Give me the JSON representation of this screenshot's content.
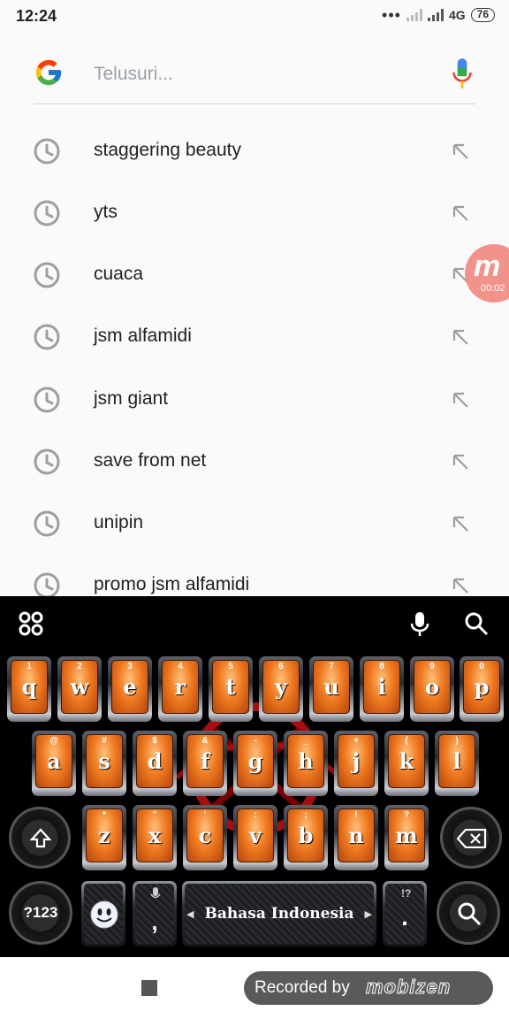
{
  "status_bar": {
    "time": "12:24",
    "network": "4G",
    "battery": "76"
  },
  "search": {
    "placeholder": "Telusuri...",
    "logo": "google-g-icon",
    "voice_icon": "mic-icon"
  },
  "suggestions": [
    {
      "text": "staggering beauty",
      "icon": "history-clock-icon"
    },
    {
      "text": "yts",
      "icon": "history-clock-icon"
    },
    {
      "text": "cuaca",
      "icon": "history-clock-icon"
    },
    {
      "text": "jsm alfamidi",
      "icon": "history-clock-icon"
    },
    {
      "text": "jsm giant",
      "icon": "history-clock-icon"
    },
    {
      "text": "save from net",
      "icon": "history-clock-icon"
    },
    {
      "text": "unipin",
      "icon": "history-clock-icon"
    },
    {
      "text": "promo jsm alfamidi",
      "icon": "history-clock-icon"
    }
  ],
  "recorder_bubble": {
    "time": "00:02"
  },
  "keyboard": {
    "row1": [
      {
        "hint": "1",
        "key": "q"
      },
      {
        "hint": "2",
        "key": "w"
      },
      {
        "hint": "3",
        "key": "e"
      },
      {
        "hint": "4",
        "key": "r"
      },
      {
        "hint": "5",
        "key": "t"
      },
      {
        "hint": "6",
        "key": "y"
      },
      {
        "hint": "7",
        "key": "u"
      },
      {
        "hint": "8",
        "key": "i"
      },
      {
        "hint": "9",
        "key": "o"
      },
      {
        "hint": "0",
        "key": "p"
      }
    ],
    "row2": [
      {
        "hint": "@",
        "key": "a"
      },
      {
        "hint": "#",
        "key": "s"
      },
      {
        "hint": "$",
        "key": "d"
      },
      {
        "hint": "&",
        "key": "f"
      },
      {
        "hint": "-",
        "key": "g"
      },
      {
        "hint": "_",
        "key": "h"
      },
      {
        "hint": "+",
        "key": "j"
      },
      {
        "hint": "(",
        "key": "k"
      },
      {
        "hint": ")",
        "key": "l"
      }
    ],
    "row3": [
      {
        "hint": "*",
        "key": "z"
      },
      {
        "hint": "\"",
        "key": "x"
      },
      {
        "hint": "'",
        "key": "c"
      },
      {
        "hint": ":",
        "key": "v"
      },
      {
        "hint": ";",
        "key": "b"
      },
      {
        "hint": "!",
        "key": "n"
      },
      {
        "hint": "?",
        "key": "m"
      }
    ],
    "symbols_label": "?123",
    "comma": ",",
    "period": ".",
    "period_hint": "!?",
    "space_label": "Bahasa Indonesia"
  },
  "nav_bar": {
    "recorded_by": "Recorded by",
    "brand": "mobizen"
  }
}
